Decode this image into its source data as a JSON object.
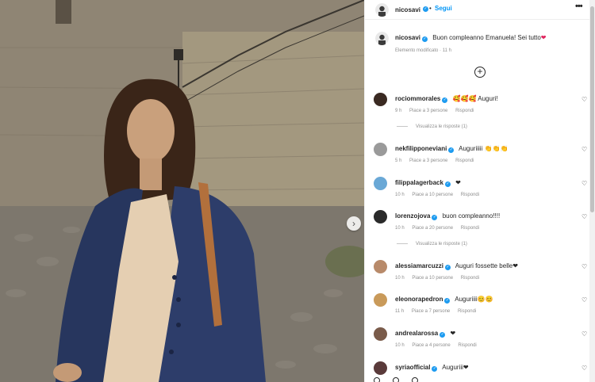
{
  "header": {
    "username": "nicosavi",
    "separator": "•",
    "follow_label": "Segui",
    "more_icon": "more-horizontal-icon"
  },
  "caption": {
    "username": "nicosavi",
    "text": "Buon compleanno Emanuela! Sei tutto",
    "emoji": "❤",
    "meta": "Elemento modificato · 11 h"
  },
  "comments": [
    {
      "username": "rociommorales",
      "text": "🥰🥰🥰 Auguri!",
      "time": "9 h",
      "likes": "Piace a 3 persone",
      "reply": "Rispondi",
      "replies": "Visualizza le risposte (1)",
      "avatar_color": "#3a2a22"
    },
    {
      "username": "nekfilipponeviani",
      "text": "Auguriiiii 👏👏👏",
      "time": "5 h",
      "likes": "Piace a 3 persone",
      "reply": "Rispondi",
      "avatar_color": "#9a9a9a"
    },
    {
      "username": "filippalagerback",
      "text": "❤",
      "time": "10 h",
      "likes": "Piace a 10 persone",
      "reply": "Rispondi",
      "avatar_color": "#6aa8d6"
    },
    {
      "username": "lorenzojova",
      "text": "buon compleanno!!!!",
      "time": "10 h",
      "likes": "Piace a 20 persone",
      "reply": "Rispondi",
      "replies": "Visualizza le risposte (1)",
      "avatar_color": "#2a2a2a"
    },
    {
      "username": "alessiamarcuzzi",
      "text": "Auguri fossette belle❤",
      "time": "10 h",
      "likes": "Piace a 10 persone",
      "reply": "Rispondi",
      "avatar_color": "#b88a6a"
    },
    {
      "username": "eleonorapedron",
      "text": "Auguriiii😊😊",
      "time": "11 h",
      "likes": "Piace a 7 persone",
      "reply": "Rispondi",
      "avatar_color": "#c99a5a"
    },
    {
      "username": "andrealarossa",
      "text": "❤",
      "time": "10 h",
      "likes": "Piace a 4 persone",
      "reply": "Rispondi",
      "avatar_color": "#7a5b4a"
    },
    {
      "username": "syriaofficial",
      "text": "Auguriii❤",
      "avatar_color": "#5a3a3a"
    }
  ],
  "icons": {
    "verified": "verified-badge-icon",
    "add": "add-circle-icon",
    "like": "heart-outline-icon",
    "next": "chevron-right-icon"
  },
  "glyphs": {
    "verified": "✓",
    "add": "+",
    "heart": "♡",
    "next": "›",
    "more": "•••"
  },
  "colors": {
    "link": "#0095f6",
    "verified": "#1d9bf0",
    "meta": "#8e8e8e",
    "heart": "#e0245e"
  }
}
